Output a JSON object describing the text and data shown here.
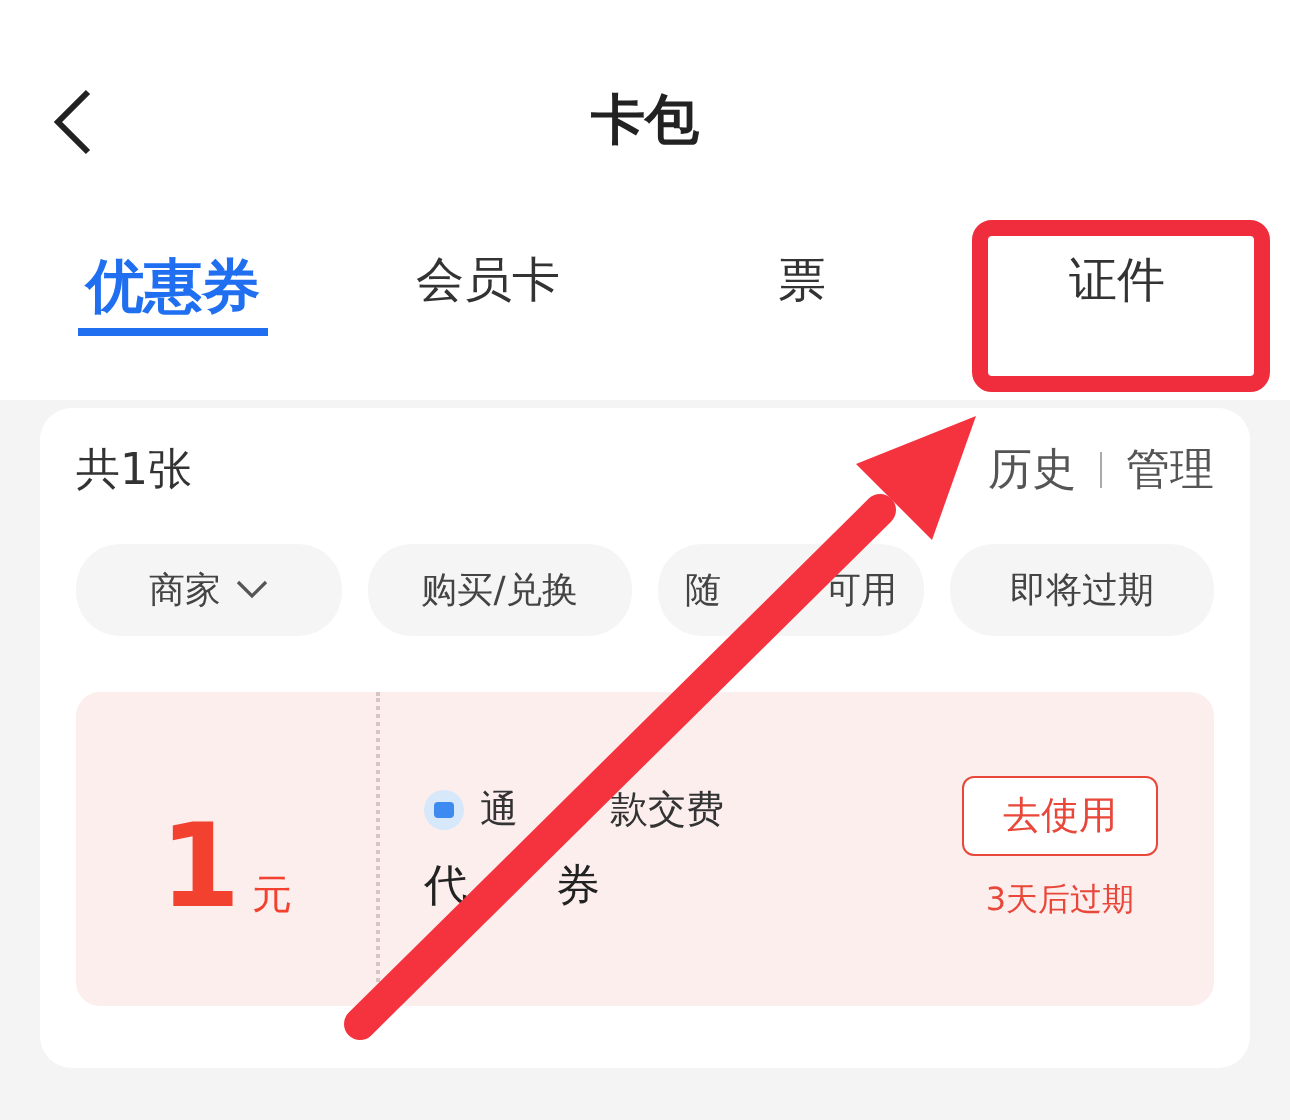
{
  "header": {
    "title": "卡包"
  },
  "tabs": [
    {
      "label": "优惠券",
      "selected": true
    },
    {
      "label": "会员卡",
      "selected": false
    },
    {
      "label": "票",
      "selected": false
    },
    {
      "label": "证件",
      "selected": false,
      "highlighted": true
    }
  ],
  "summary": {
    "count": "共1张",
    "links": [
      "历史",
      "管理"
    ]
  },
  "filters": [
    {
      "label": [
        "商家"
      ],
      "dropdown": true
    },
    {
      "label": [
        "购买/兑换"
      ],
      "dropdown": false
    },
    {
      "label": [
        "随",
        "可用"
      ],
      "dropdown": false
    },
    {
      "label": [
        "即将过期"
      ],
      "dropdown": false
    }
  ],
  "coupon": {
    "amount": "1",
    "unit": "元",
    "merchant": [
      "通",
      "款交费"
    ],
    "name": [
      "代",
      "券"
    ],
    "action": "去使用",
    "expiry": "3天后过期"
  }
}
